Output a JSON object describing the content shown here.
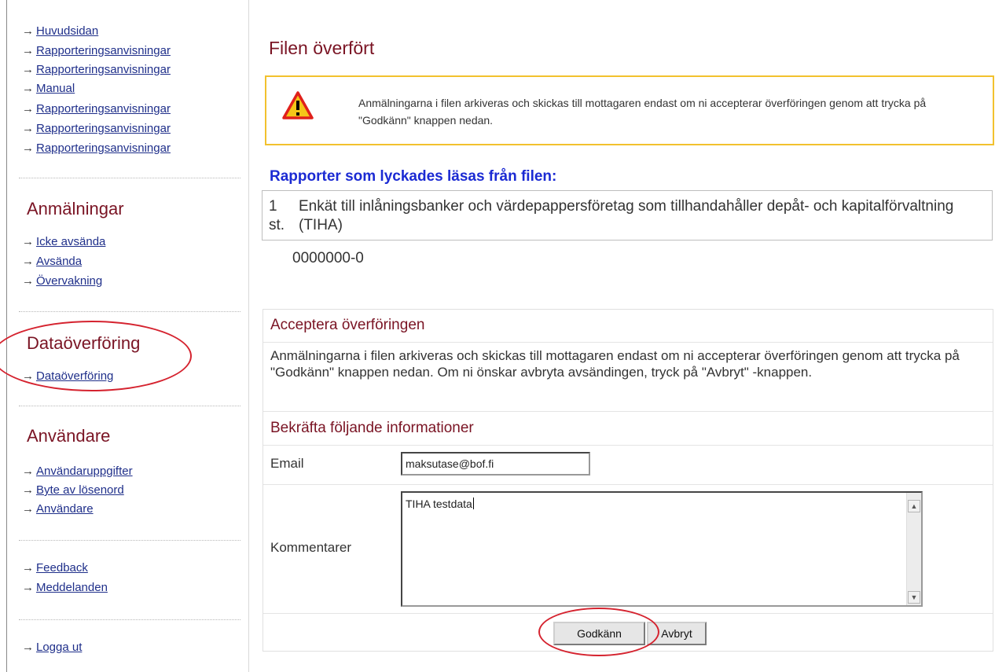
{
  "sidebar": {
    "top_links": [
      {
        "label": "Huvudsidan"
      },
      {
        "label": "Rapporteringsanvisningar"
      },
      {
        "label": "Rapporteringsanvisningar"
      },
      {
        "label": "Manual"
      },
      {
        "label": "Rapporteringsanvisningar"
      },
      {
        "label": "Rapporteringsanvisningar"
      },
      {
        "label": "Rapporteringsanvisningar"
      }
    ],
    "anmalningar": {
      "heading": "Anmälningar",
      "links": [
        {
          "label": "Icke avsända"
        },
        {
          "label": "Avsända"
        },
        {
          "label": "Övervakning"
        }
      ]
    },
    "dataoverforing": {
      "heading": "Dataöverföring",
      "links": [
        {
          "label": "Dataöverföring"
        }
      ]
    },
    "anvandare": {
      "heading": "Användare",
      "links": [
        {
          "label": "Användaruppgifter"
        },
        {
          "label": "Byte av lösenord"
        },
        {
          "label": "Användare"
        }
      ]
    },
    "misc_links": [
      {
        "label": "Feedback"
      },
      {
        "label": "Meddelanden"
      }
    ],
    "logout": {
      "label": "Logga ut"
    },
    "arrow": "→"
  },
  "main": {
    "title": "Filen överfört",
    "warning": {
      "text": "Anmälningarna i filen arkiveras och skickas till mottagaren endast om ni accepterar överföringen genom att trycka på \"Godkänn\" knappen nedan.",
      "icon": "warning-triangle-icon"
    },
    "reports": {
      "heading": "Rapporter som lyckades läsas från filen:",
      "count": "1 st.",
      "description": "Enkät till inlåningsbanker och värdepappersföretag som tillhandahåller depåt- och kapitalförvaltning (TIHA)",
      "id": "0000000-0"
    },
    "accept": {
      "title": "Acceptera överföringen",
      "text": "Anmälningarna i filen arkiveras och skickas till mottagaren endast om ni accepterar överföringen genom att trycka på \"Godkänn\" knappen nedan. Om ni önskar avbryta avsändingen, tryck på \"Avbryt\" -knappen.",
      "confirm_title": "Bekräfta följande informationer",
      "email_label": "Email",
      "email_value": "maksutase@bof.fi",
      "comments_label": "Kommentarer",
      "comments_value": "TIHA testdata",
      "approve_label": "Godkänn",
      "cancel_label": "Avbryt"
    }
  },
  "colors": {
    "accent_red": "#7a1424",
    "link_blue": "#1f2f8a",
    "heading_blue": "#1b2ad3",
    "warning_border": "#f2c12e",
    "annotation_red": "#d5232f"
  }
}
